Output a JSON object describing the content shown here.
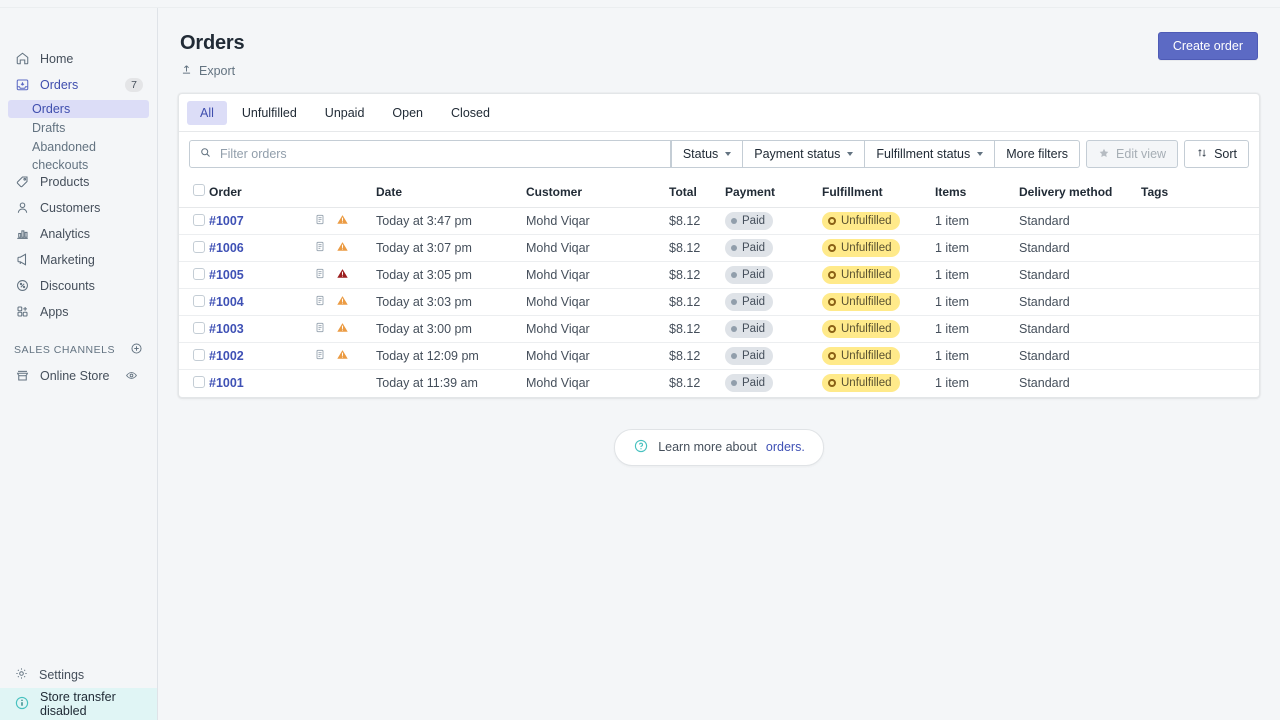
{
  "sidebar": {
    "items": [
      {
        "label": "Home",
        "icon": "home-icon",
        "active": false,
        "badge": ""
      },
      {
        "label": "Orders",
        "icon": "orders-inbox-icon",
        "active": true,
        "badge": "7"
      },
      {
        "label": "Products",
        "icon": "tag-icon",
        "active": false,
        "badge": ""
      },
      {
        "label": "Customers",
        "icon": "person-icon",
        "active": false,
        "badge": ""
      },
      {
        "label": "Analytics",
        "icon": "bar-chart-icon",
        "active": false,
        "badge": ""
      },
      {
        "label": "Marketing",
        "icon": "megaphone-icon",
        "active": false,
        "badge": ""
      },
      {
        "label": "Discounts",
        "icon": "discount-badge-icon",
        "active": false,
        "badge": ""
      },
      {
        "label": "Apps",
        "icon": "apps-grid-plus-icon",
        "active": false,
        "badge": ""
      }
    ],
    "suborders": [
      {
        "label": "Orders",
        "active": true
      },
      {
        "label": "Drafts",
        "active": false
      },
      {
        "label": "Abandoned checkouts",
        "active": false
      }
    ],
    "sales_channels_label": "SALES CHANNELS",
    "sales_channels_add_icon": "plus-circle-icon",
    "online_store": {
      "label": "Online Store",
      "icon": "storefront-icon",
      "action_icon": "eye-icon"
    },
    "settings": {
      "label": "Settings",
      "icon": "gear-icon"
    },
    "store_transfer": {
      "label": "Store transfer disabled",
      "icon": "info-circle-icon"
    }
  },
  "header": {
    "title": "Orders",
    "export_label": "Export",
    "export_icon": "upload-icon",
    "create_label": "Create order"
  },
  "tabs": [
    {
      "label": "All",
      "active": true
    },
    {
      "label": "Unfulfilled",
      "active": false
    },
    {
      "label": "Unpaid",
      "active": false
    },
    {
      "label": "Open",
      "active": false
    },
    {
      "label": "Closed",
      "active": false
    }
  ],
  "filters": {
    "search_placeholder": "Filter orders",
    "search_value": "",
    "search_icon": "search-icon",
    "status_label": "Status",
    "payment_status_label": "Payment status",
    "fulfillment_status_label": "Fulfillment status",
    "more_filters_label": "More filters",
    "edit_view_label": "Edit view",
    "edit_view_icon": "star-icon",
    "edit_view_disabled": true,
    "sort_label": "Sort",
    "sort_icon": "sort-arrows-icon"
  },
  "table": {
    "columns": [
      "Order",
      "Date",
      "Customer",
      "Total",
      "Payment",
      "Fulfillment",
      "Items",
      "Delivery method",
      "Tags"
    ],
    "rows": [
      {
        "order": "#1007",
        "note_icon": "note-icon",
        "alert_icon": "warning-triangle-icon",
        "alert_level": "warning",
        "date": "Today at 3:47 pm",
        "customer": "Mohd Viqar",
        "total": "$8.12",
        "payment": "Paid",
        "fulfillment": "Unfulfilled",
        "items": "1 item",
        "delivery": "Standard",
        "tags": ""
      },
      {
        "order": "#1006",
        "note_icon": "note-icon",
        "alert_icon": "warning-triangle-icon",
        "alert_level": "warning",
        "date": "Today at 3:07 pm",
        "customer": "Mohd Viqar",
        "total": "$8.12",
        "payment": "Paid",
        "fulfillment": "Unfulfilled",
        "items": "1 item",
        "delivery": "Standard",
        "tags": ""
      },
      {
        "order": "#1005",
        "note_icon": "note-icon",
        "alert_icon": "warning-triangle-icon",
        "alert_level": "critical",
        "date": "Today at 3:05 pm",
        "customer": "Mohd Viqar",
        "total": "$8.12",
        "payment": "Paid",
        "fulfillment": "Unfulfilled",
        "items": "1 item",
        "delivery": "Standard",
        "tags": ""
      },
      {
        "order": "#1004",
        "note_icon": "note-icon",
        "alert_icon": "warning-triangle-icon",
        "alert_level": "warning",
        "date": "Today at 3:03 pm",
        "customer": "Mohd Viqar",
        "total": "$8.12",
        "payment": "Paid",
        "fulfillment": "Unfulfilled",
        "items": "1 item",
        "delivery": "Standard",
        "tags": ""
      },
      {
        "order": "#1003",
        "note_icon": "note-icon",
        "alert_icon": "warning-triangle-icon",
        "alert_level": "warning",
        "date": "Today at 3:00 pm",
        "customer": "Mohd Viqar",
        "total": "$8.12",
        "payment": "Paid",
        "fulfillment": "Unfulfilled",
        "items": "1 item",
        "delivery": "Standard",
        "tags": ""
      },
      {
        "order": "#1002",
        "note_icon": "note-icon",
        "alert_icon": "warning-triangle-icon",
        "alert_level": "warning",
        "date": "Today at 12:09 pm",
        "customer": "Mohd Viqar",
        "total": "$8.12",
        "payment": "Paid",
        "fulfillment": "Unfulfilled",
        "items": "1 item",
        "delivery": "Standard",
        "tags": ""
      },
      {
        "order": "#1001",
        "note_icon": "",
        "alert_icon": "",
        "alert_level": "",
        "date": "Today at 11:39 am",
        "customer": "Mohd Viqar",
        "total": "$8.12",
        "payment": "Paid",
        "fulfillment": "Unfulfilled",
        "items": "1 item",
        "delivery": "Standard",
        "tags": ""
      }
    ]
  },
  "footer": {
    "help_icon": "question-circle-icon",
    "text": "Learn more about",
    "link": "orders."
  },
  "colors": {
    "accent": "#5c6ac4",
    "link": "#3f51b5",
    "active_nav_bg": "#dcddf7",
    "warning": "#eb9b43",
    "critical": "#9c1f1f",
    "paid_badge_bg": "#dfe3e8",
    "unfulfilled_badge_bg": "#ffea8a",
    "teal": "#47c1bf"
  }
}
